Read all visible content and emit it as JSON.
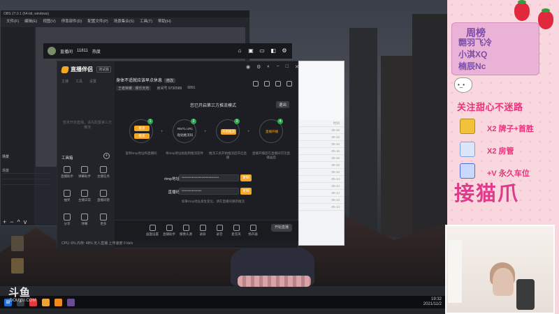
{
  "obs": {
    "title": "OBS 27.0.1 (64-bit, windows)",
    "menu": [
      "文件(F)",
      "编辑(E)",
      "视图(V)",
      "停靠部件(D)",
      "配置文件(P)",
      "场景集合(S)",
      "工具(T)",
      "帮助(H)"
    ],
    "scenes_header": "场景",
    "scenes": [
      "场景"
    ],
    "bottom_buttons": [
      "+",
      "−",
      "^",
      "v"
    ]
  },
  "player": {
    "room_label": "直播间",
    "room_id": "11811",
    "viewers": "热度"
  },
  "assistant": {
    "app_name": "直播伴侣",
    "version": "测试版",
    "side_tabs": [
      "主播",
      "工具",
      "设置"
    ],
    "empty_hint": "暂未开启直播，请先配置第三方推流",
    "tools_header": "工具箱",
    "tools": [
      {
        "label": "直播助手"
      },
      {
        "label": "弹幕助手"
      },
      {
        "label": "主播任务"
      },
      {
        "label": "抽奖"
      },
      {
        "label": "主播日常"
      },
      {
        "label": "直播间管"
      },
      {
        "label": "分享"
      },
      {
        "label": "弹幕"
      },
      {
        "label": "更多"
      }
    ],
    "status_bar": "CPU: 6%  内存: 48%  无人直播  上传速度  0 kb/s",
    "stream_title": "身体不适就应该早点休息",
    "stream_title_badge": "修改",
    "meta_category": "王者荣耀 · 娱乐天地",
    "meta_id": "房间号 9730589",
    "meta_fans": "6891",
    "mode_title": "您已开启第三方推流模式",
    "mode_close": "退出",
    "steps": [
      {
        "num": "1",
        "pill_top": "推流",
        "pill_bottom": "推流",
        "desc": "复制rtmp地址和直播码"
      },
      {
        "num": "2",
        "text_top": "RMTL URL",
        "text_bottom": "粘贴推流码",
        "desc": "将rtmp地址粘贴到推流软件"
      },
      {
        "num": "3",
        "pill_top": "开始推流",
        "desc": "推流工具开始推流后开启直播"
      },
      {
        "num": "4",
        "text_top": "直播开播",
        "desc": "直播开播后在直播间可见直播画面"
      }
    ],
    "field_rtmp_label": "rtmp地址",
    "field_rtmp_value": "••••••••••••••••••••••••••",
    "field_code_label": "直播码",
    "field_code_value": "••••••••••••••",
    "copy_label": "复制",
    "hint": "如果rtmp地址发生变化，请在直播间重新推流",
    "bottom_tools": [
      "画面设置",
      "直播助手",
      "摄像头源",
      "录屏",
      "录音",
      "麦克风",
      "扬声器"
    ],
    "start_button": "开始直播"
  },
  "listwin": {
    "rows": [
      {
        "l": "",
        "r": "时间"
      },
      {
        "l": "",
        "r": "05-16"
      },
      {
        "l": "",
        "r": "05-16"
      },
      {
        "l": "",
        "r": "05-16"
      },
      {
        "l": "",
        "r": "05-16"
      },
      {
        "l": "",
        "r": "05-15"
      },
      {
        "l": "",
        "r": "05-15"
      },
      {
        "l": "",
        "r": "05-15"
      },
      {
        "l": "",
        "r": "05-14"
      },
      {
        "l": "",
        "r": "05-14"
      },
      {
        "l": "",
        "r": "05-14"
      },
      {
        "l": "",
        "r": "05-13"
      },
      {
        "l": "",
        "r": "05-13"
      }
    ]
  },
  "taskbar": {
    "time": "19:32",
    "date": "2021/11/2"
  },
  "watermark": {
    "logo": "斗鱼",
    "url": "DOUYU.COM"
  },
  "overlay": {
    "rank_title": "周榜",
    "rank_names": [
      "翾羽飞冷",
      "小淇XQ",
      "楠辰Nc"
    ],
    "follow": "关注甜心不迷路",
    "perks": [
      {
        "text": "X2 牌子+首胜",
        "color": "#f2c23a"
      },
      {
        "text": "X2 房管",
        "color": "#7ca4e0"
      },
      {
        "text": "+V 永久车位",
        "color": "#4a6fd8"
      }
    ],
    "catch": "接猫爪"
  },
  "colors": {
    "accent_orange": "#f5a623",
    "step_green": "#2ea84e",
    "overlay_pink": "#e8337a"
  }
}
